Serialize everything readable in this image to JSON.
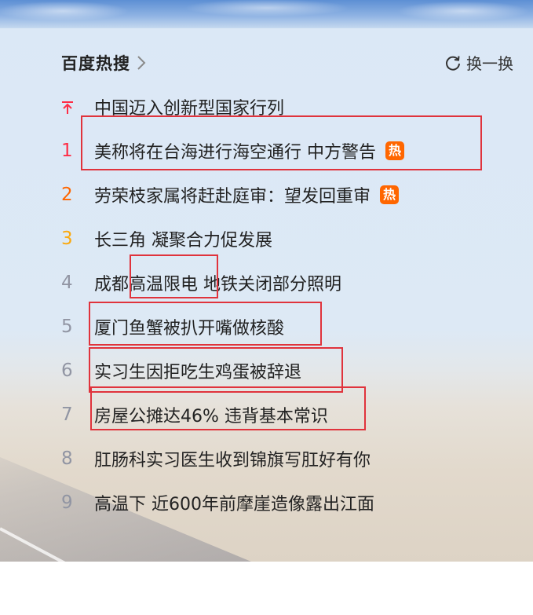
{
  "header": {
    "title": "百度热搜",
    "refresh_label": "换一换"
  },
  "items": [
    {
      "rank": "",
      "pinned": true,
      "text": "中国迈入创新型国家行列",
      "badge": ""
    },
    {
      "rank": "1",
      "text": "美称将在台海进行海空通行 中方警告",
      "badge": "热"
    },
    {
      "rank": "2",
      "text": "劳荣枝家属将赶赴庭审：望发回重审",
      "badge": "热"
    },
    {
      "rank": "3",
      "text": "长三角 凝聚合力促发展",
      "badge": ""
    },
    {
      "rank": "4",
      "text": "成都高温限电 地铁关闭部分照明",
      "badge": ""
    },
    {
      "rank": "5",
      "text": "厦门鱼蟹被扒开嘴做核酸",
      "badge": ""
    },
    {
      "rank": "6",
      "text": "实习生因拒吃生鸡蛋被辞退",
      "badge": ""
    },
    {
      "rank": "7",
      "text": "房屋公摊达46% 违背基本常识",
      "badge": ""
    },
    {
      "rank": "8",
      "text": "肛肠科实习医生收到锦旗写肛好有你",
      "badge": ""
    },
    {
      "rank": "9",
      "text": "高温下 近600年前摩崖造像露出江面",
      "badge": ""
    }
  ],
  "colors": {
    "rank1": "#fe2d46",
    "rank2": "#ff6600",
    "rank3": "#faa90e",
    "rank_other": "#9195a3",
    "hot_badge": "#ff6600",
    "annotation_box": "#e0333c"
  },
  "icons": {
    "header_chevron": "chevron-right-icon",
    "refresh": "refresh-icon",
    "pinned": "pin-top-icon"
  }
}
